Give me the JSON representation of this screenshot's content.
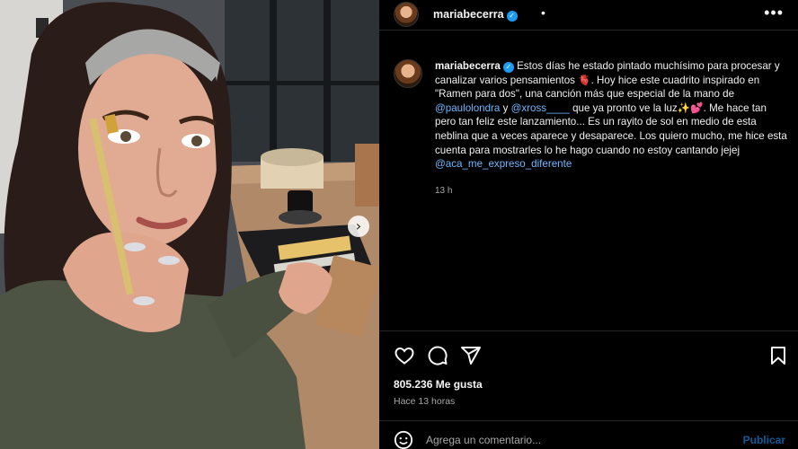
{
  "post": {
    "username": "mariabecerra",
    "header_dot": "•",
    "more_label": "•••",
    "caption": {
      "part1": " Estos días he estado pintado muchísimo para procesar y canalizar varios pensamientos 🫀. Hoy hice este cuadrito inspirado en \"Ramen para dos\", una canción más que especial de la mano de ",
      "mention1": "@paulolondra",
      "part2": " y ",
      "mention2": "@xross____",
      "part3": " que ya pronto ve la luz✨💕. Me hace tan pero tan feliz este lanzamiento... Es un rayito de sol en medio de esta neblina que a veces aparece y desaparece. Los quiero mucho, me hice esta cuenta para mostrarles lo he hago cuando no estoy cantando jejej ",
      "mention3": "@aca_me_expreso_diferente"
    },
    "caption_time": "13 h",
    "likes": "805.236 Me gusta",
    "time_ago": "Hace 13 horas",
    "photo_next": "›"
  },
  "comment": {
    "placeholder": "Agrega un comentario...",
    "publish_label": "Publicar"
  },
  "icons": [
    "heart-icon",
    "comment-icon",
    "share-icon",
    "bookmark-icon",
    "emoji-icon",
    "verified-icon",
    "more-icon"
  ],
  "colors": {
    "background": "#000000",
    "mention": "#6fb8ff",
    "verified": "#1d9bf0",
    "publish": "#0d5c99",
    "secondary_text": "#a8a8a8"
  }
}
